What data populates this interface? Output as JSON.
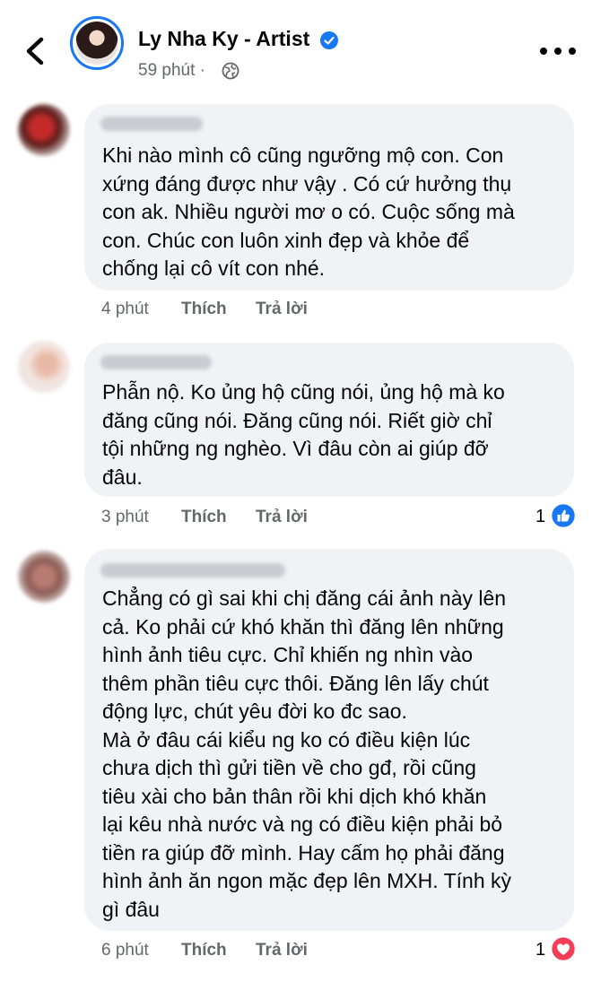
{
  "header": {
    "page_name": "Ly Nha Ky - Artist",
    "post_time": "59 phút"
  },
  "comments": [
    {
      "text": "Khi nào mình cô cũng ngưỡng mộ con. Con\nxứng đáng được  như vậy . Có cứ hưởng thụ\ncon ak. Nhiều người mơ o có. Cuộc sống mà\ncon. Chúc con luôn xinh đẹp và khỏe để\nchống lại cô vít con nhé.",
      "time": "4 phút",
      "like_label": "Thích",
      "reply_label": "Trả lời"
    },
    {
      "text": "Phẫn nộ. Ko ủng hộ cũng nói, ủng hộ mà ko\nđăng cũng nói. Đăng cũng nói. Riết giờ chỉ\ntội những ng nghèo. Vì đâu còn ai giúp đỡ\nđâu.",
      "time": "3 phút",
      "like_label": "Thích",
      "reply_label": "Trả lời",
      "reaction_count": "1",
      "reaction": "like-icon"
    },
    {
      "text": "Chẳng có gì sai khi chị đăng cái ảnh này lên\ncả. Ko phải cứ khó khăn thì đăng lên những\nhình ảnh tiêu cực. Chỉ khiến ng nhìn vào\nthêm phần tiêu cực thôi. Đăng lên lấy chút\nđộng lực, chút yêu đời ko đc sao.\nMà ở đâu cái kiểu ng ko có điều kiện lúc\nchưa dịch thì gửi tiền về cho gđ, rồi cũng\ntiêu xài cho bản thân rồi khi dịch khó khăn\nlại kêu nhà nước và ng có điều kiện phải bỏ\ntiền ra giúp đỡ mình. Hay cấm họ phải đăng\nhình ảnh ăn ngon mặc đẹp lên MXH. Tính kỳ\ngì đâu",
      "time": "6 phút",
      "like_label": "Thích",
      "reply_label": "Trả lời",
      "reaction_count": "1",
      "reaction": "love-icon"
    }
  ],
  "colors": {
    "bubble": "#f0f2f5",
    "meta": "#65676b",
    "like_blue": "#1877f2",
    "love_red": "#f33e58"
  }
}
